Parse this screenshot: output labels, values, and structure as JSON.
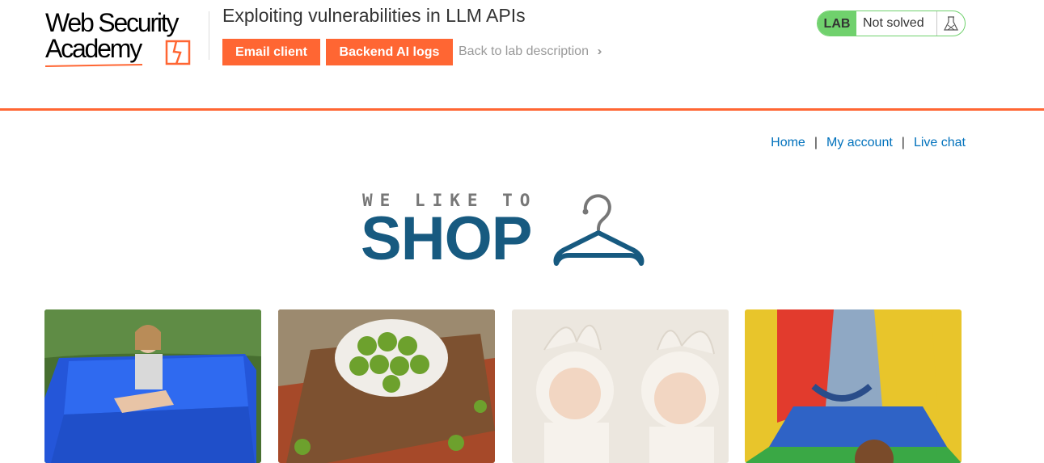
{
  "header": {
    "logo_line1": "Web Security",
    "logo_line2": "Academy",
    "lab_title": "Exploiting vulnerabilities in LLM APIs",
    "buttons": {
      "email_client": "Email client",
      "backend_ai_logs": "Backend AI logs"
    },
    "back_link": "Back to lab description",
    "lab_status": {
      "badge": "LAB",
      "status": "Not solved",
      "icon": "flask-icon"
    },
    "colors": {
      "accent": "#ff6633",
      "lab_green": "#70d16d",
      "link": "#0071bc",
      "shop_blue": "#175a80"
    }
  },
  "nav": {
    "home": "Home",
    "sep1": "|",
    "my_account": "My account",
    "sep2": "|",
    "live_chat": "Live chat"
  },
  "banner": {
    "tagline": "WE LIKE TO",
    "headline": "SHOP",
    "icon": "hanger-icon"
  },
  "products": [
    {
      "image": "girl on blue inflatable cushion on grass"
    },
    {
      "image": "brussels sprouts in white bowl on wooden board"
    },
    {
      "image": "two babies in bunny hats"
    },
    {
      "image": "inflatable bouncy castle with swings"
    }
  ]
}
